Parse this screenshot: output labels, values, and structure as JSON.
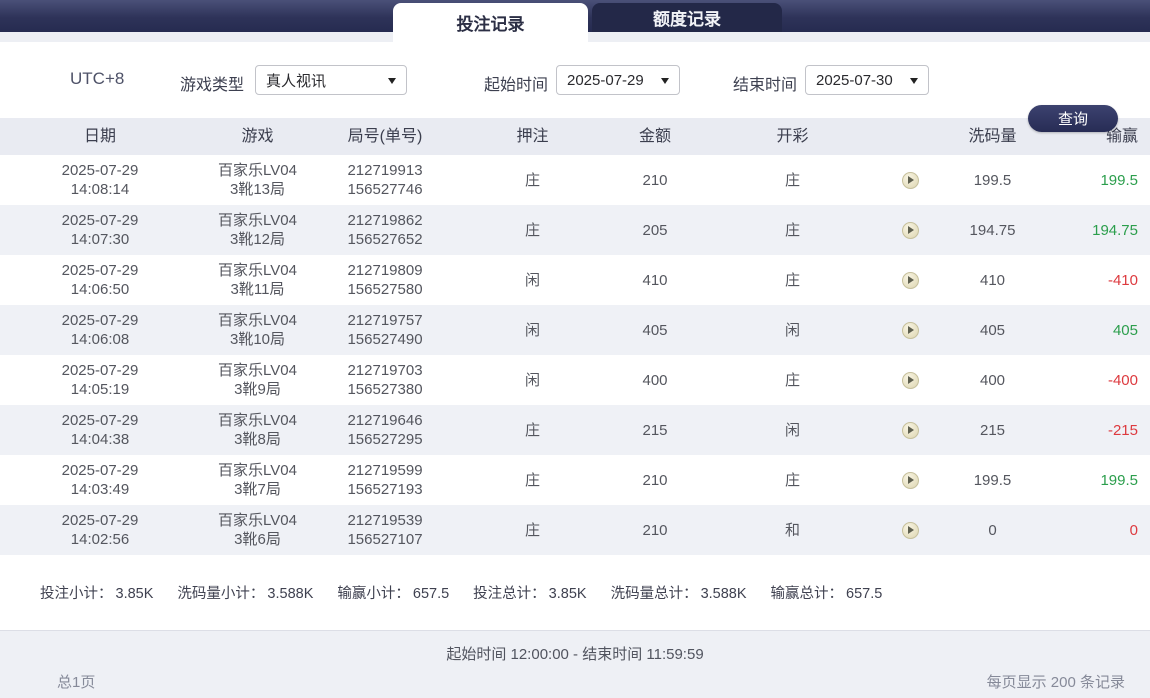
{
  "tabs": {
    "bet_records": "投注记录",
    "quota_records": "额度记录"
  },
  "filters": {
    "timezone": "UTC+8",
    "game_type_label": "游戏类型",
    "game_type_value": "真人视讯",
    "start_time_label": "起始时间",
    "start_time_value": "2025-07-29",
    "end_time_label": "结束时间",
    "end_time_value": "2025-07-30",
    "query_label": "查询"
  },
  "table": {
    "columns": {
      "date": "日期",
      "game": "游戏",
      "round": "局号(单号)",
      "bet": "押注",
      "amount": "金额",
      "result": "开彩",
      "rolling": "洗码量",
      "winloss": "输赢"
    },
    "rows": [
      {
        "date": "2025-07-29",
        "time": "14:08:14",
        "game": "百家乐LV04",
        "shoe": "3靴13局",
        "round_no": "212719913",
        "order_no": "156527746",
        "bet": "庄",
        "amount": "210",
        "result": "庄",
        "rolling": "199.5",
        "winloss": "199.5",
        "winloss_color": "green"
      },
      {
        "date": "2025-07-29",
        "time": "14:07:30",
        "game": "百家乐LV04",
        "shoe": "3靴12局",
        "round_no": "212719862",
        "order_no": "156527652",
        "bet": "庄",
        "amount": "205",
        "result": "庄",
        "rolling": "194.75",
        "winloss": "194.75",
        "winloss_color": "green"
      },
      {
        "date": "2025-07-29",
        "time": "14:06:50",
        "game": "百家乐LV04",
        "shoe": "3靴11局",
        "round_no": "212719809",
        "order_no": "156527580",
        "bet": "闲",
        "amount": "410",
        "result": "庄",
        "rolling": "410",
        "winloss": "-410",
        "winloss_color": "red"
      },
      {
        "date": "2025-07-29",
        "time": "14:06:08",
        "game": "百家乐LV04",
        "shoe": "3靴10局",
        "round_no": "212719757",
        "order_no": "156527490",
        "bet": "闲",
        "amount": "405",
        "result": "闲",
        "rolling": "405",
        "winloss": "405",
        "winloss_color": "green"
      },
      {
        "date": "2025-07-29",
        "time": "14:05:19",
        "game": "百家乐LV04",
        "shoe": "3靴9局",
        "round_no": "212719703",
        "order_no": "156527380",
        "bet": "闲",
        "amount": "400",
        "result": "庄",
        "rolling": "400",
        "winloss": "-400",
        "winloss_color": "red"
      },
      {
        "date": "2025-07-29",
        "time": "14:04:38",
        "game": "百家乐LV04",
        "shoe": "3靴8局",
        "round_no": "212719646",
        "order_no": "156527295",
        "bet": "庄",
        "amount": "215",
        "result": "闲",
        "rolling": "215",
        "winloss": "-215",
        "winloss_color": "red"
      },
      {
        "date": "2025-07-29",
        "time": "14:03:49",
        "game": "百家乐LV04",
        "shoe": "3靴7局",
        "round_no": "212719599",
        "order_no": "156527193",
        "bet": "庄",
        "amount": "210",
        "result": "庄",
        "rolling": "199.5",
        "winloss": "199.5",
        "winloss_color": "green"
      },
      {
        "date": "2025-07-29",
        "time": "14:02:56",
        "game": "百家乐LV04",
        "shoe": "3靴6局",
        "round_no": "212719539",
        "order_no": "156527107",
        "bet": "庄",
        "amount": "210",
        "result": "和",
        "rolling": "0",
        "winloss": "0",
        "winloss_color": "red"
      }
    ]
  },
  "summary": {
    "items": [
      {
        "label": "投注小计：",
        "value": "3.85K"
      },
      {
        "label": "洗码量小计：",
        "value": "3.588K"
      },
      {
        "label": "输赢小计：",
        "value": "657.5"
      },
      {
        "label": "投注总计：",
        "value": "3.85K"
      },
      {
        "label": "洗码量总计：",
        "value": "3.588K"
      },
      {
        "label": "输赢总计：",
        "value": "657.5"
      }
    ]
  },
  "footer": {
    "time_range": "起始时间 12:00:00 - 结束时间 11:59:59",
    "page_info": "总1页",
    "per_page": "每页显示 200 条记录"
  },
  "colors": {
    "win_green": "#2b9e4c",
    "loss_red": "#dd3a3f",
    "navy_bar": "#2b3057",
    "inactive_tab": "#232848"
  }
}
